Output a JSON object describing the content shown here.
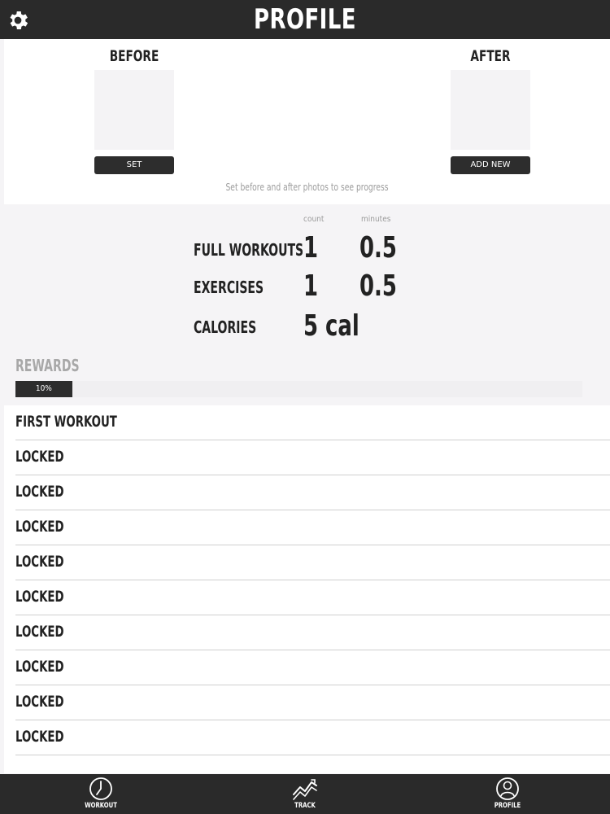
{
  "header": {
    "title": "PROFILE",
    "settings_icon": "gear-icon"
  },
  "photos": {
    "before": {
      "label": "BEFORE",
      "button": "SET"
    },
    "after": {
      "label": "AFTER",
      "button": "ADD NEW"
    },
    "hint": "Set before and after photos to see progress"
  },
  "stats": {
    "columns": {
      "count": "count",
      "minutes": "minutes"
    },
    "full_workouts": {
      "label": "FULL WORKOUTS",
      "count": "1",
      "minutes": "0.5"
    },
    "exercises": {
      "label": "EXERCISES",
      "count": "1",
      "minutes": "0.5"
    },
    "calories": {
      "label": "CALORIES",
      "value": "5 cal"
    }
  },
  "rewards": {
    "title": "REWARDS",
    "progress_label": "10%",
    "progress_percent": 10,
    "items": [
      "FIRST WORKOUT",
      "LOCKED",
      "LOCKED",
      "LOCKED",
      "LOCKED",
      "LOCKED",
      "LOCKED",
      "LOCKED",
      "LOCKED",
      "LOCKED"
    ]
  },
  "tabs": [
    {
      "label": "WORKOUT",
      "icon": "clock-icon"
    },
    {
      "label": "TRACK",
      "icon": "chart-line-icon"
    },
    {
      "label": "PROFILE",
      "icon": "user-icon"
    }
  ]
}
